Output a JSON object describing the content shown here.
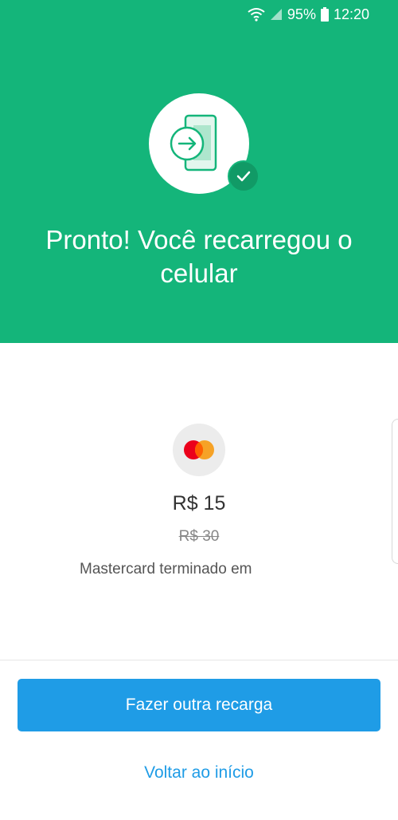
{
  "status_bar": {
    "battery": "95%",
    "time": "12:20",
    "icons": [
      "wifi-icon",
      "signal-icon",
      "battery-icon"
    ]
  },
  "header": {
    "title": "Pronto! Você recarregou o celular",
    "hero_icon": "phone-recharge-icon",
    "badge_icon": "check-icon",
    "background": "#14b57a"
  },
  "payment": {
    "card_icon": "mastercard-icon",
    "price": "R$ 15",
    "old_price": "R$ 30",
    "card_text": "Mastercard terminado em"
  },
  "actions": {
    "primary_label": "Fazer outra recarga",
    "secondary_label": "Voltar ao início",
    "accent": "#1f9ce6"
  }
}
